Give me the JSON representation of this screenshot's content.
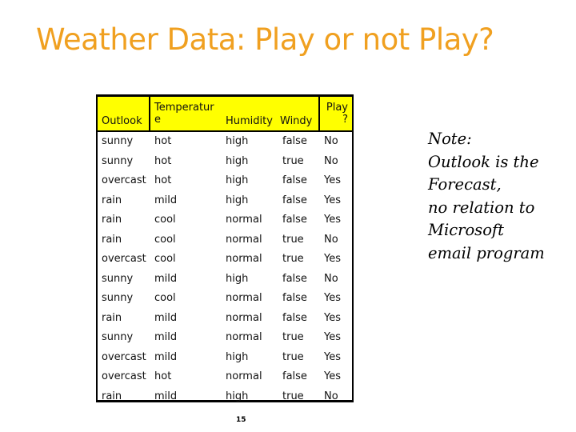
{
  "slide": {
    "title": "Weather Data: Play or not Play?",
    "page_number": "15",
    "accent_color": "#f0a020",
    "header_bg_color": "#ffff00"
  },
  "table": {
    "headers": [
      "Outlook",
      "Temperatur\ne",
      "Humidity",
      "Windy",
      "Play\n?"
    ],
    "rows": [
      [
        "sunny",
        "hot",
        "high",
        "false",
        "No"
      ],
      [
        "sunny",
        "hot",
        "high",
        "true",
        "No"
      ],
      [
        "overcast",
        "hot",
        "high",
        "false",
        "Yes"
      ],
      [
        "rain",
        "mild",
        "high",
        "false",
        "Yes"
      ],
      [
        "rain",
        "cool",
        "normal",
        "false",
        "Yes"
      ],
      [
        "rain",
        "cool",
        "normal",
        "true",
        "No"
      ],
      [
        "overcast",
        "cool",
        "normal",
        "true",
        "Yes"
      ],
      [
        "sunny",
        "mild",
        "high",
        "false",
        "No"
      ],
      [
        "sunny",
        "cool",
        "normal",
        "false",
        "Yes"
      ],
      [
        "rain",
        "mild",
        "normal",
        "false",
        "Yes"
      ],
      [
        "sunny",
        "mild",
        "normal",
        "true",
        "Yes"
      ],
      [
        "overcast",
        "mild",
        "high",
        "true",
        "Yes"
      ],
      [
        "overcast",
        "hot",
        "normal",
        "false",
        "Yes"
      ],
      [
        "rain",
        "mild",
        "high",
        "true",
        "No"
      ]
    ]
  },
  "note": {
    "lines": [
      "Note:",
      "Outlook is the",
      "Forecast,",
      "no relation to",
      "Microsoft",
      "email program"
    ]
  }
}
